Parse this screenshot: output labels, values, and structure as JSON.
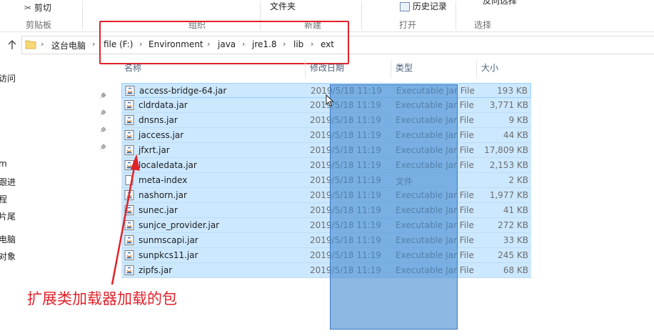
{
  "ribbon": {
    "cut_label": "剪切",
    "clipboard_group": "剪贴板",
    "organize_group": "组织",
    "new_group": "新建",
    "new_folder_label": "文件夹",
    "open_group": "打开",
    "history_label": "历史记录",
    "select_group": "选择",
    "select_label": "反向选择"
  },
  "breadcrumb": {
    "items": [
      "这台电脑",
      "file (F:)",
      "Environment",
      "java",
      "jre1.8",
      "lib",
      "ext"
    ]
  },
  "nav": {
    "items": [
      "访问",
      "",
      "",
      "",
      "m",
      "跟进",
      "程",
      "片尾",
      "电脑",
      "对象"
    ]
  },
  "columns": {
    "name": "名称",
    "date": "修改日期",
    "type": "类型",
    "size": "大小"
  },
  "files": [
    {
      "name": "access-bridge-64.jar",
      "date": "2019/5/18 11:19",
      "type": "Executable Jar File",
      "size": "193 KB",
      "icon": "jar-icon"
    },
    {
      "name": "cldrdata.jar",
      "date": "2019/5/18 11:19",
      "type": "Executable Jar File",
      "size": "3,771 KB",
      "icon": "jar-icon"
    },
    {
      "name": "dnsns.jar",
      "date": "2019/5/18 11:19",
      "type": "Executable Jar File",
      "size": "9 KB",
      "icon": "jar-icon"
    },
    {
      "name": "jaccess.jar",
      "date": "2019/5/18 11:19",
      "type": "Executable Jar File",
      "size": "44 KB",
      "icon": "jar-icon"
    },
    {
      "name": "jfxrt.jar",
      "date": "2019/5/18 11:19",
      "type": "Executable Jar File",
      "size": "17,809 KB",
      "icon": "jar-icon"
    },
    {
      "name": "localedata.jar",
      "date": "2019/5/18 11:19",
      "type": "Executable Jar File",
      "size": "2,153 KB",
      "icon": "jar-icon"
    },
    {
      "name": "meta-index",
      "date": "2019/5/18 11:19",
      "type": "文件",
      "size": "2 KB",
      "icon": "file-icon"
    },
    {
      "name": "nashorn.jar",
      "date": "2019/5/18 11:19",
      "type": "Executable Jar File",
      "size": "1,977 KB",
      "icon": "jar-icon"
    },
    {
      "name": "sunec.jar",
      "date": "2019/5/18 11:19",
      "type": "Executable Jar File",
      "size": "41 KB",
      "icon": "jar-icon"
    },
    {
      "name": "sunjce_provider.jar",
      "date": "2019/5/18 11:19",
      "type": "Executable Jar File",
      "size": "272 KB",
      "icon": "jar-icon"
    },
    {
      "name": "sunmscapi.jar",
      "date": "2019/5/18 11:19",
      "type": "Executable Jar File",
      "size": "33 KB",
      "icon": "jar-icon"
    },
    {
      "name": "sunpkcs11.jar",
      "date": "2019/5/18 11:19",
      "type": "Executable Jar File",
      "size": "245 KB",
      "icon": "jar-icon"
    },
    {
      "name": "zipfs.jar",
      "date": "2019/5/18 11:19",
      "type": "Executable Jar File",
      "size": "68 KB",
      "icon": "jar-icon"
    }
  ],
  "annotation": {
    "text": "扩展类加载器加载的包",
    "color": "#e0222a"
  },
  "colors": {
    "selection": "#cce8ff",
    "overlay": "#4a8cd2"
  }
}
